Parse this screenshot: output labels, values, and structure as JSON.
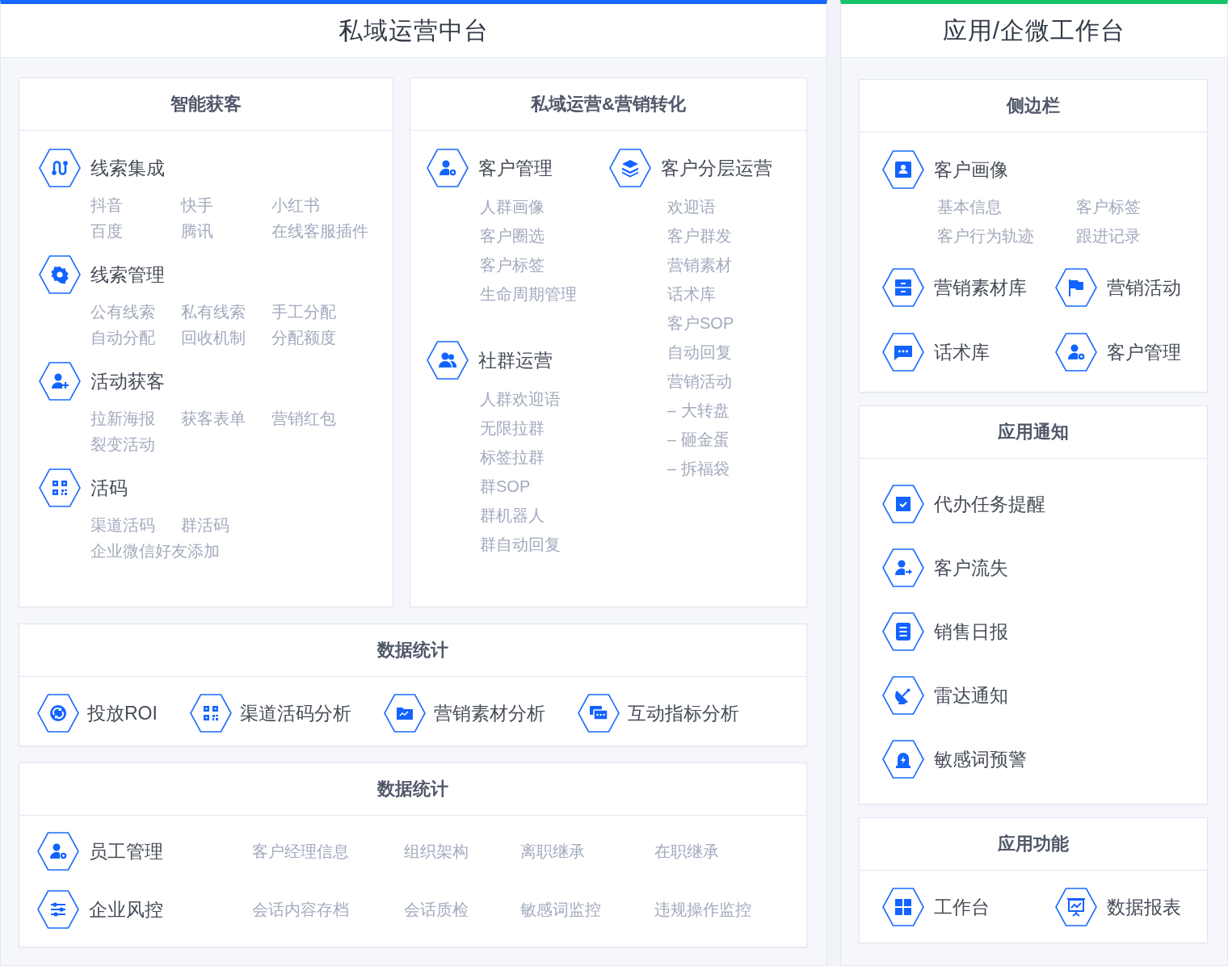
{
  "left_panel": {
    "title": "私域运营中台",
    "acquisition": {
      "title": "智能获客",
      "groups": [
        {
          "title": "线索集成",
          "rows": [
            [
              "抖音",
              "快手",
              "小红书"
            ],
            [
              "百度",
              "腾讯",
              "在线客服插件"
            ]
          ]
        },
        {
          "title": "线索管理",
          "rows": [
            [
              "公有线索",
              "私有线索",
              "手工分配"
            ],
            [
              "自动分配",
              "回收机制",
              "分配额度"
            ]
          ]
        },
        {
          "title": "活动获客",
          "rows": [
            [
              "拉新海报",
              "获客表单",
              "营销红包"
            ],
            [
              "裂变活动"
            ]
          ]
        },
        {
          "title": "活码",
          "rows": [
            [
              "渠道活码",
              "群活码"
            ],
            [
              "企业微信好友添加"
            ]
          ]
        }
      ]
    },
    "operations": {
      "title": "私域运营&营销转化",
      "columns": [
        [
          {
            "title": "客户管理",
            "items": [
              "人群画像",
              "客户圈选",
              "客户标签",
              "生命周期管理"
            ]
          },
          {
            "title": "社群运营",
            "items": [
              "人群欢迎语",
              "无限拉群",
              "标签拉群",
              "群SOP",
              "群机器人",
              "群自动回复"
            ]
          }
        ],
        [
          {
            "title": "客户分层运营",
            "items": [
              "欢迎语",
              "客户群发",
              "营销素材",
              "话术库",
              "客户SOP",
              "自动回复",
              "营销活动",
              "– 大转盘",
              "– 砸金蛋",
              "– 拆福袋"
            ]
          }
        ]
      ]
    },
    "analytics": {
      "title": "数据统计",
      "items": [
        "投放ROI",
        "渠道活码分析",
        "营销素材分析",
        "互动指标分析"
      ]
    },
    "management": {
      "title": "数据统计",
      "rows": [
        {
          "title": "员工管理",
          "items": [
            "客户经理信息",
            "组织架构",
            "离职继承",
            "在职继承"
          ]
        },
        {
          "title": "企业风控",
          "items": [
            "会话内容存档",
            "会话质检",
            "敏感词监控",
            "违规操作监控"
          ]
        }
      ]
    }
  },
  "right_panel": {
    "title": "应用/企微工作台",
    "sidebar": {
      "title": "侧边栏",
      "profile": {
        "title": "客户画像",
        "rows": [
          [
            "基本信息",
            "客户标签"
          ],
          [
            "客户行为轨迹",
            "跟进记录"
          ]
        ]
      },
      "items": [
        "营销素材库",
        "营销活动",
        "话术库",
        "客户管理"
      ]
    },
    "notifications": {
      "title": "应用通知",
      "items": [
        "代办任务提醒",
        "客户流失",
        "销售日报",
        "雷达通知",
        "敏感词预警"
      ]
    },
    "functions": {
      "title": "应用功能",
      "items": [
        "工作台",
        "数据报表"
      ]
    }
  }
}
